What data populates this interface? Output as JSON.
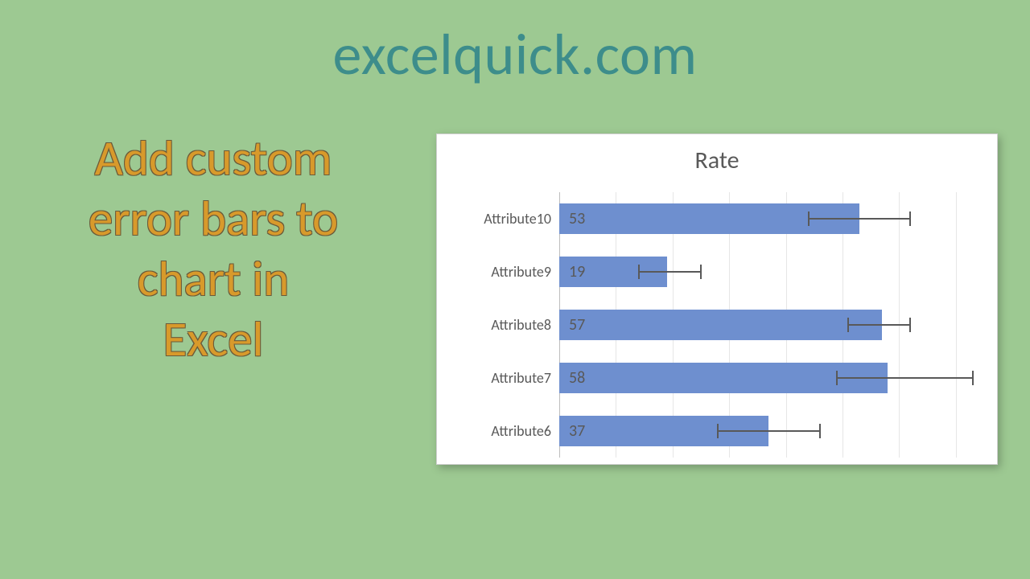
{
  "site_title": "excelquick.com",
  "headline_lines": [
    "Add custom",
    "error bars to",
    "chart in",
    "Excel"
  ],
  "chart_data": {
    "type": "bar",
    "orientation": "horizontal",
    "title": "Rate",
    "xlabel": "",
    "ylabel": "",
    "xlim": [
      0,
      75
    ],
    "grid_step": 10,
    "categories": [
      "Attribute10",
      "Attribute9",
      "Attribute8",
      "Attribute7",
      "Attribute6"
    ],
    "values": [
      53,
      19,
      57,
      58,
      37
    ],
    "error_minus": [
      9,
      5,
      6,
      9,
      9
    ],
    "error_plus": [
      9,
      6,
      5,
      15,
      9
    ]
  }
}
